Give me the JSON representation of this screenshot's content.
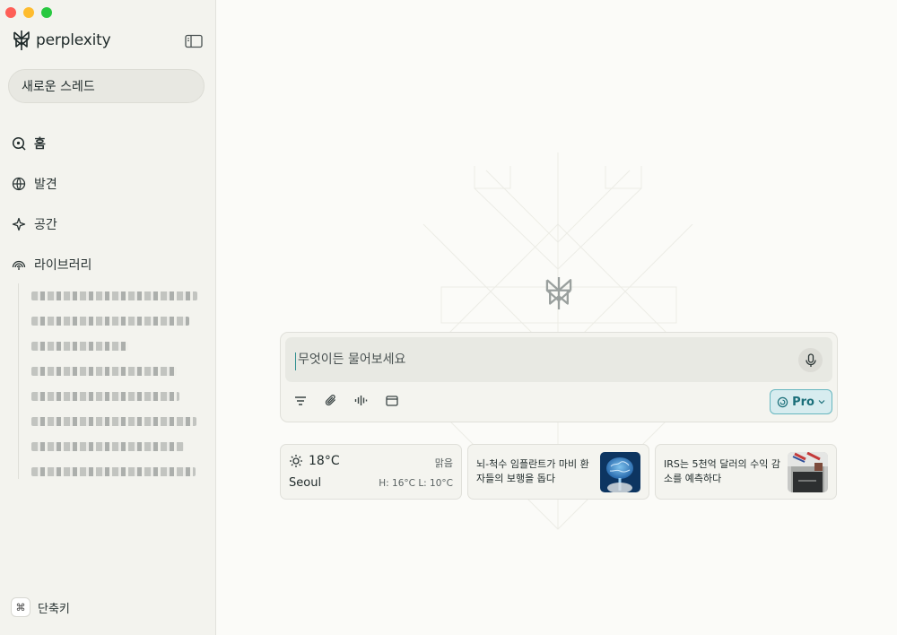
{
  "window": {
    "brand_name": "perplexity"
  },
  "sidebar": {
    "new_thread_label": "새로운 스레드",
    "nav": [
      {
        "label": "홈",
        "icon": "home-search-icon"
      },
      {
        "label": "발견",
        "icon": "globe-icon"
      },
      {
        "label": "공간",
        "icon": "sparkle-icon"
      },
      {
        "label": "라이브러리",
        "icon": "library-icon"
      }
    ],
    "shortcut_label": "단축키",
    "shortcut_key": "⌘"
  },
  "ask": {
    "placeholder": "무엇이든 물어보세요",
    "pro_label": "Pro"
  },
  "weather": {
    "temperature": "18°C",
    "condition": "맑음",
    "city": "Seoul",
    "high_low": "H: 16°C L: 10°C"
  },
  "news": [
    {
      "title": "뇌-척수 임플란트가 마비 환자들의 보행을 돕다",
      "thumb_icon": "brain-image"
    },
    {
      "title": "IRS는 5천억 달러의 수익 감소를 예측하다",
      "thumb_icon": "building-image"
    }
  ],
  "colors": {
    "accent": "#1b6f7a",
    "sidebar_bg": "#f3f3ee",
    "main_bg": "#fbfbf8"
  }
}
